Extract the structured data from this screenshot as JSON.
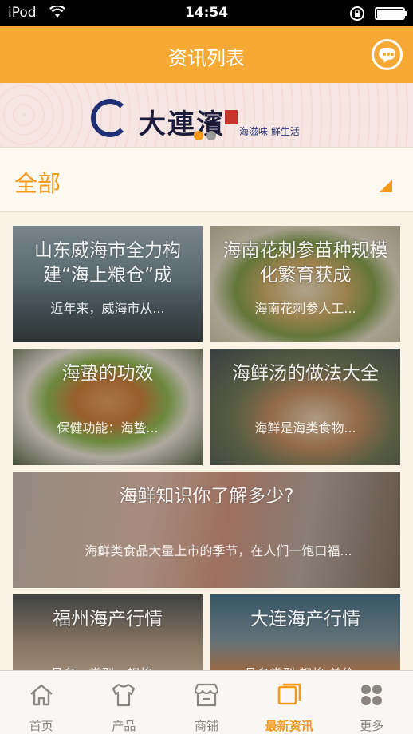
{
  "status_bar": {
    "carrier": "iPod",
    "time": "14:54"
  },
  "header": {
    "title": "资讯列表",
    "message_icon": "chat-bubble-icon"
  },
  "banner": {
    "logo_text": "大連濱",
    "logo_subtitle": "海滋味  鲜生活",
    "active_slide": 1,
    "slide_count": 2
  },
  "filter": {
    "selected": "全部"
  },
  "articles": [
    {
      "title": "山东威海市全力构建“海上粮仓”成",
      "summary": "近年来，威海市从..."
    },
    {
      "title": "海南花刺参苗种规模化繁育获成",
      "summary": "海南花刺参人工..."
    },
    {
      "title": "海蛰的功效",
      "summary": "保健功能：海蛰..."
    },
    {
      "title": "海鲜汤的做法大全",
      "summary": "海鲜是海类食物..."
    },
    {
      "title": "海鲜知识你了解多少?",
      "summary": "海鲜类食品大量上市的季节，在人们一饱口福..."
    },
    {
      "title": "福州海产行情",
      "summary": "品名、类型、规格..."
    },
    {
      "title": "大连海产行情",
      "summary": "品名类型 规格 单价..."
    }
  ],
  "tabs": [
    {
      "label": "首页",
      "icon": "home-icon"
    },
    {
      "label": "产品",
      "icon": "shirt-icon"
    },
    {
      "label": "商铺",
      "icon": "store-icon"
    },
    {
      "label": "最新资讯",
      "icon": "news-icon",
      "active": true
    },
    {
      "label": "更多",
      "icon": "grid-icon"
    }
  ],
  "colors": {
    "accent": "#f6a934",
    "accent_text": "#f39a1b",
    "background": "#fbf3e6"
  }
}
